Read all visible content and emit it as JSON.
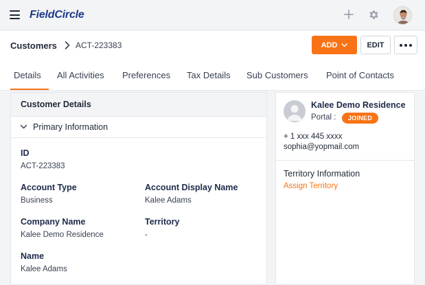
{
  "app": {
    "logo": "FieldCircle",
    "colors": {
      "accent": "#f97316",
      "brand": "#1e3a8a"
    }
  },
  "topbar": {
    "menu_icon": "hamburger-icon",
    "plus_icon": "plus-icon",
    "settings_icon": "gear-icon"
  },
  "breadcrumb": {
    "root": "Customers",
    "current": "ACT-223383"
  },
  "actions": {
    "add_label": "ADD",
    "edit_label": "EDIT"
  },
  "tabs": [
    {
      "label": "Details",
      "active": true
    },
    {
      "label": "All Activities"
    },
    {
      "label": "Preferences"
    },
    {
      "label": "Tax Details"
    },
    {
      "label": "Sub Customers"
    },
    {
      "label": "Point of Contacts"
    }
  ],
  "customer_details": {
    "title": "Customer Details",
    "section": "Primary Information",
    "fields": {
      "id": {
        "label": "ID",
        "value": "ACT-223383"
      },
      "account_type": {
        "label": "Account Type",
        "value": "Business"
      },
      "account_display_name": {
        "label": "Account Display Name",
        "value": "Kalee Adams"
      },
      "company_name": {
        "label": "Company Name",
        "value": "Kalee Demo Residence"
      },
      "territory": {
        "label": "Territory",
        "value": "-"
      },
      "name": {
        "label": "Name",
        "value": "Kalee Adams"
      }
    }
  },
  "side_panel": {
    "name": "Kalee Demo Residence",
    "portal_label": "Portal :",
    "portal_status": "JOINED",
    "phone": "+ 1 xxx 445 xxxx",
    "email": "sophia@yopmail.com",
    "territory_title": "Territory Information",
    "assign_link": "Assign Territory"
  }
}
